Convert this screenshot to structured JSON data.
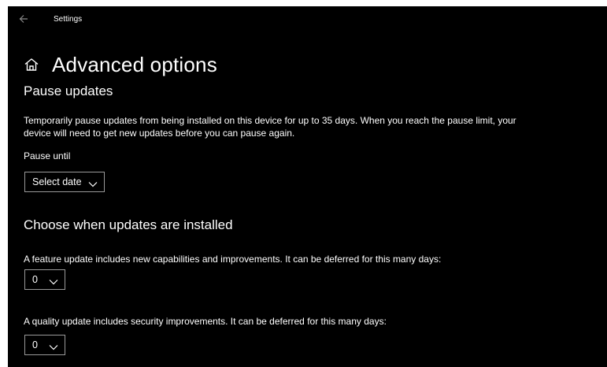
{
  "window": {
    "title": "Settings"
  },
  "page": {
    "title": "Advanced options"
  },
  "pause_updates": {
    "heading": "Pause updates",
    "description_line1": "Temporarily pause updates from being installed on this device for up to 35 days. When you reach the pause limit, your",
    "description_line2": "device will need to get new updates before you can pause again.",
    "field_label": "Pause until",
    "select_value": "Select date"
  },
  "choose_updates": {
    "heading": "Choose when updates are installed",
    "feature_text": "A feature update includes new capabilities and improvements. It can be deferred for this many days:",
    "feature_value": "0",
    "quality_text": "A quality update includes security improvements. It can be deferred for this many days:",
    "quality_value": "0"
  },
  "icons": {
    "back": "back-arrow-icon",
    "home": "home-icon",
    "dropdown": "chevron-down-icon"
  }
}
